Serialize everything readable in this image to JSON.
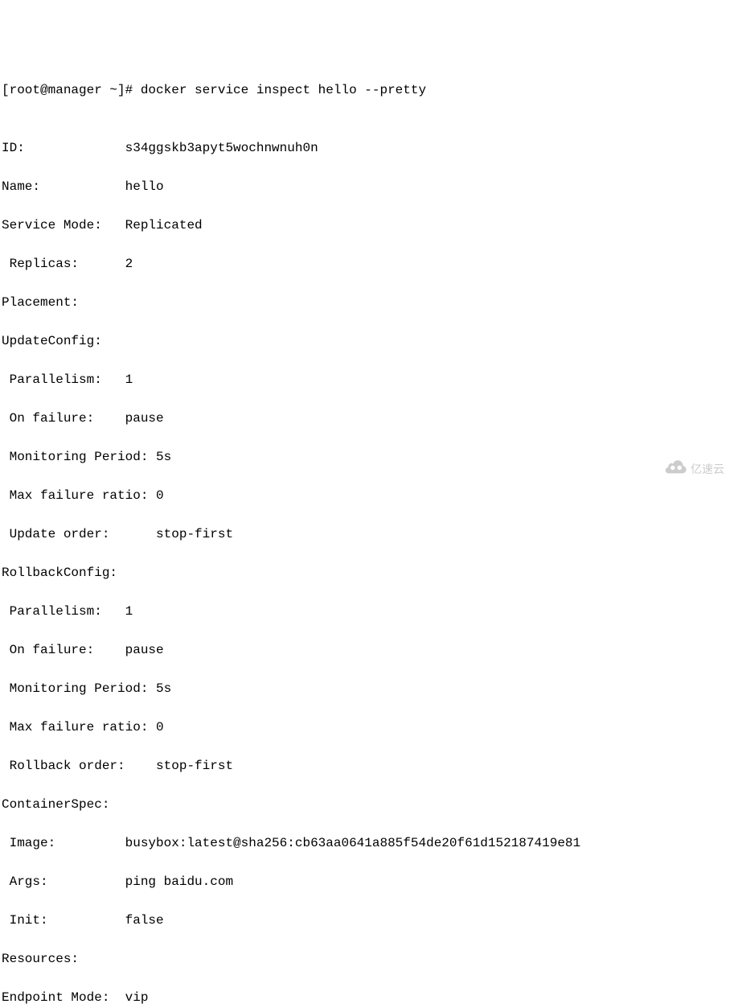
{
  "prompt": "[root@manager ~]# docker service inspect hello --pretty",
  "blank1": "",
  "id_line": "ID:             s34ggskb3apyt5wochnwnuh0n",
  "name_line": "Name:           hello",
  "mode_line": "Service Mode:   Replicated",
  "replicas_line": " Replicas:      2",
  "placement_line": "Placement:",
  "updateconfig_line": "UpdateConfig:",
  "up_parallel_line": " Parallelism:   1",
  "up_failure_line": " On failure:    pause",
  "up_monitor_line": " Monitoring Period: 5s",
  "up_maxfail_line": " Max failure ratio: 0",
  "up_order_line": " Update order:      stop-first",
  "rollbackconfig_line": "RollbackConfig:",
  "rb_parallel_line": " Parallelism:   1",
  "rb_failure_line": " On failure:    pause",
  "rb_monitor_line": " Monitoring Period: 5s",
  "rb_maxfail_line": " Max failure ratio: 0",
  "rb_order_line": " Rollback order:    stop-first",
  "containerspec_line": "ContainerSpec:",
  "image_line": " Image:         busybox:latest@sha256:cb63aa0641a885f54de20f61d152187419e81",
  "args_line": " Args:          ping baidu.com",
  "init_line": " Init:          false",
  "resources_line": "Resources:",
  "endpoint_line": "Endpoint Mode:  vip",
  "watermark_text": "亿速云"
}
